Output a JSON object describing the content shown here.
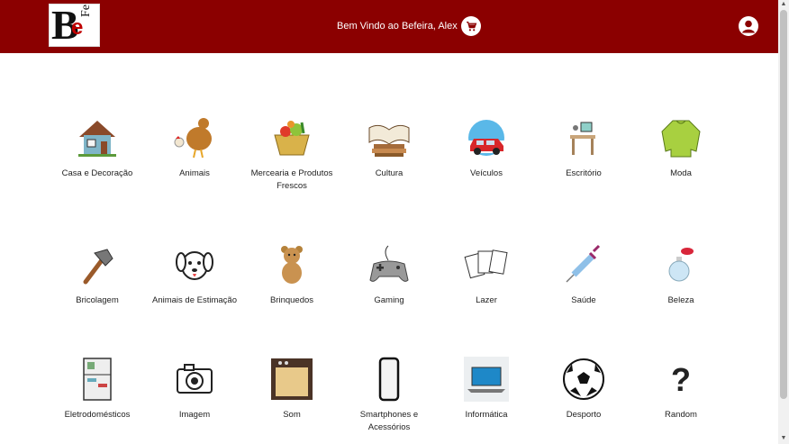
{
  "header": {
    "logo": {
      "big": "B",
      "small": "e",
      "vertical": "Feira"
    },
    "welcome": "Bem Vindo ao Befeira, Alex",
    "cart_icon": "shopping-cart-icon",
    "user_icon": "user-circle-icon",
    "colors": {
      "background": "#8b0000",
      "text": "#ffffff"
    }
  },
  "categories": [
    {
      "label": "Casa e Decoração",
      "icon": "house-icon"
    },
    {
      "label": "Animais",
      "icon": "chicken-icon"
    },
    {
      "label": "Mercearia e Produtos Frescos",
      "icon": "grocery-basket-icon"
    },
    {
      "label": "Cultura",
      "icon": "books-icon"
    },
    {
      "label": "Veículos",
      "icon": "car-icon"
    },
    {
      "label": "Escritório",
      "icon": "office-desk-icon"
    },
    {
      "label": "Moda",
      "icon": "sweater-icon"
    },
    {
      "label": "Bricolagem",
      "icon": "hammer-icon"
    },
    {
      "label": "Animais de Estimação",
      "icon": "dog-icon"
    },
    {
      "label": "Brinquedos",
      "icon": "teddy-bear-icon"
    },
    {
      "label": "Gaming",
      "icon": "gamepad-icon"
    },
    {
      "label": "Lazer",
      "icon": "playing-cards-icon"
    },
    {
      "label": "Saúde",
      "icon": "syringe-icon"
    },
    {
      "label": "Beleza",
      "icon": "perfume-icon"
    },
    {
      "label": "Eletrodomésticos",
      "icon": "refrigerator-icon"
    },
    {
      "label": "Imagem",
      "icon": "camera-icon"
    },
    {
      "label": "Som",
      "icon": "speaker-icon"
    },
    {
      "label": "Smartphones e Acessórios",
      "icon": "smartphone-icon"
    },
    {
      "label": "Informática",
      "icon": "laptop-icon"
    },
    {
      "label": "Desporto",
      "icon": "soccer-ball-icon"
    },
    {
      "label": "Random",
      "icon": "question-mark-icon"
    }
  ]
}
